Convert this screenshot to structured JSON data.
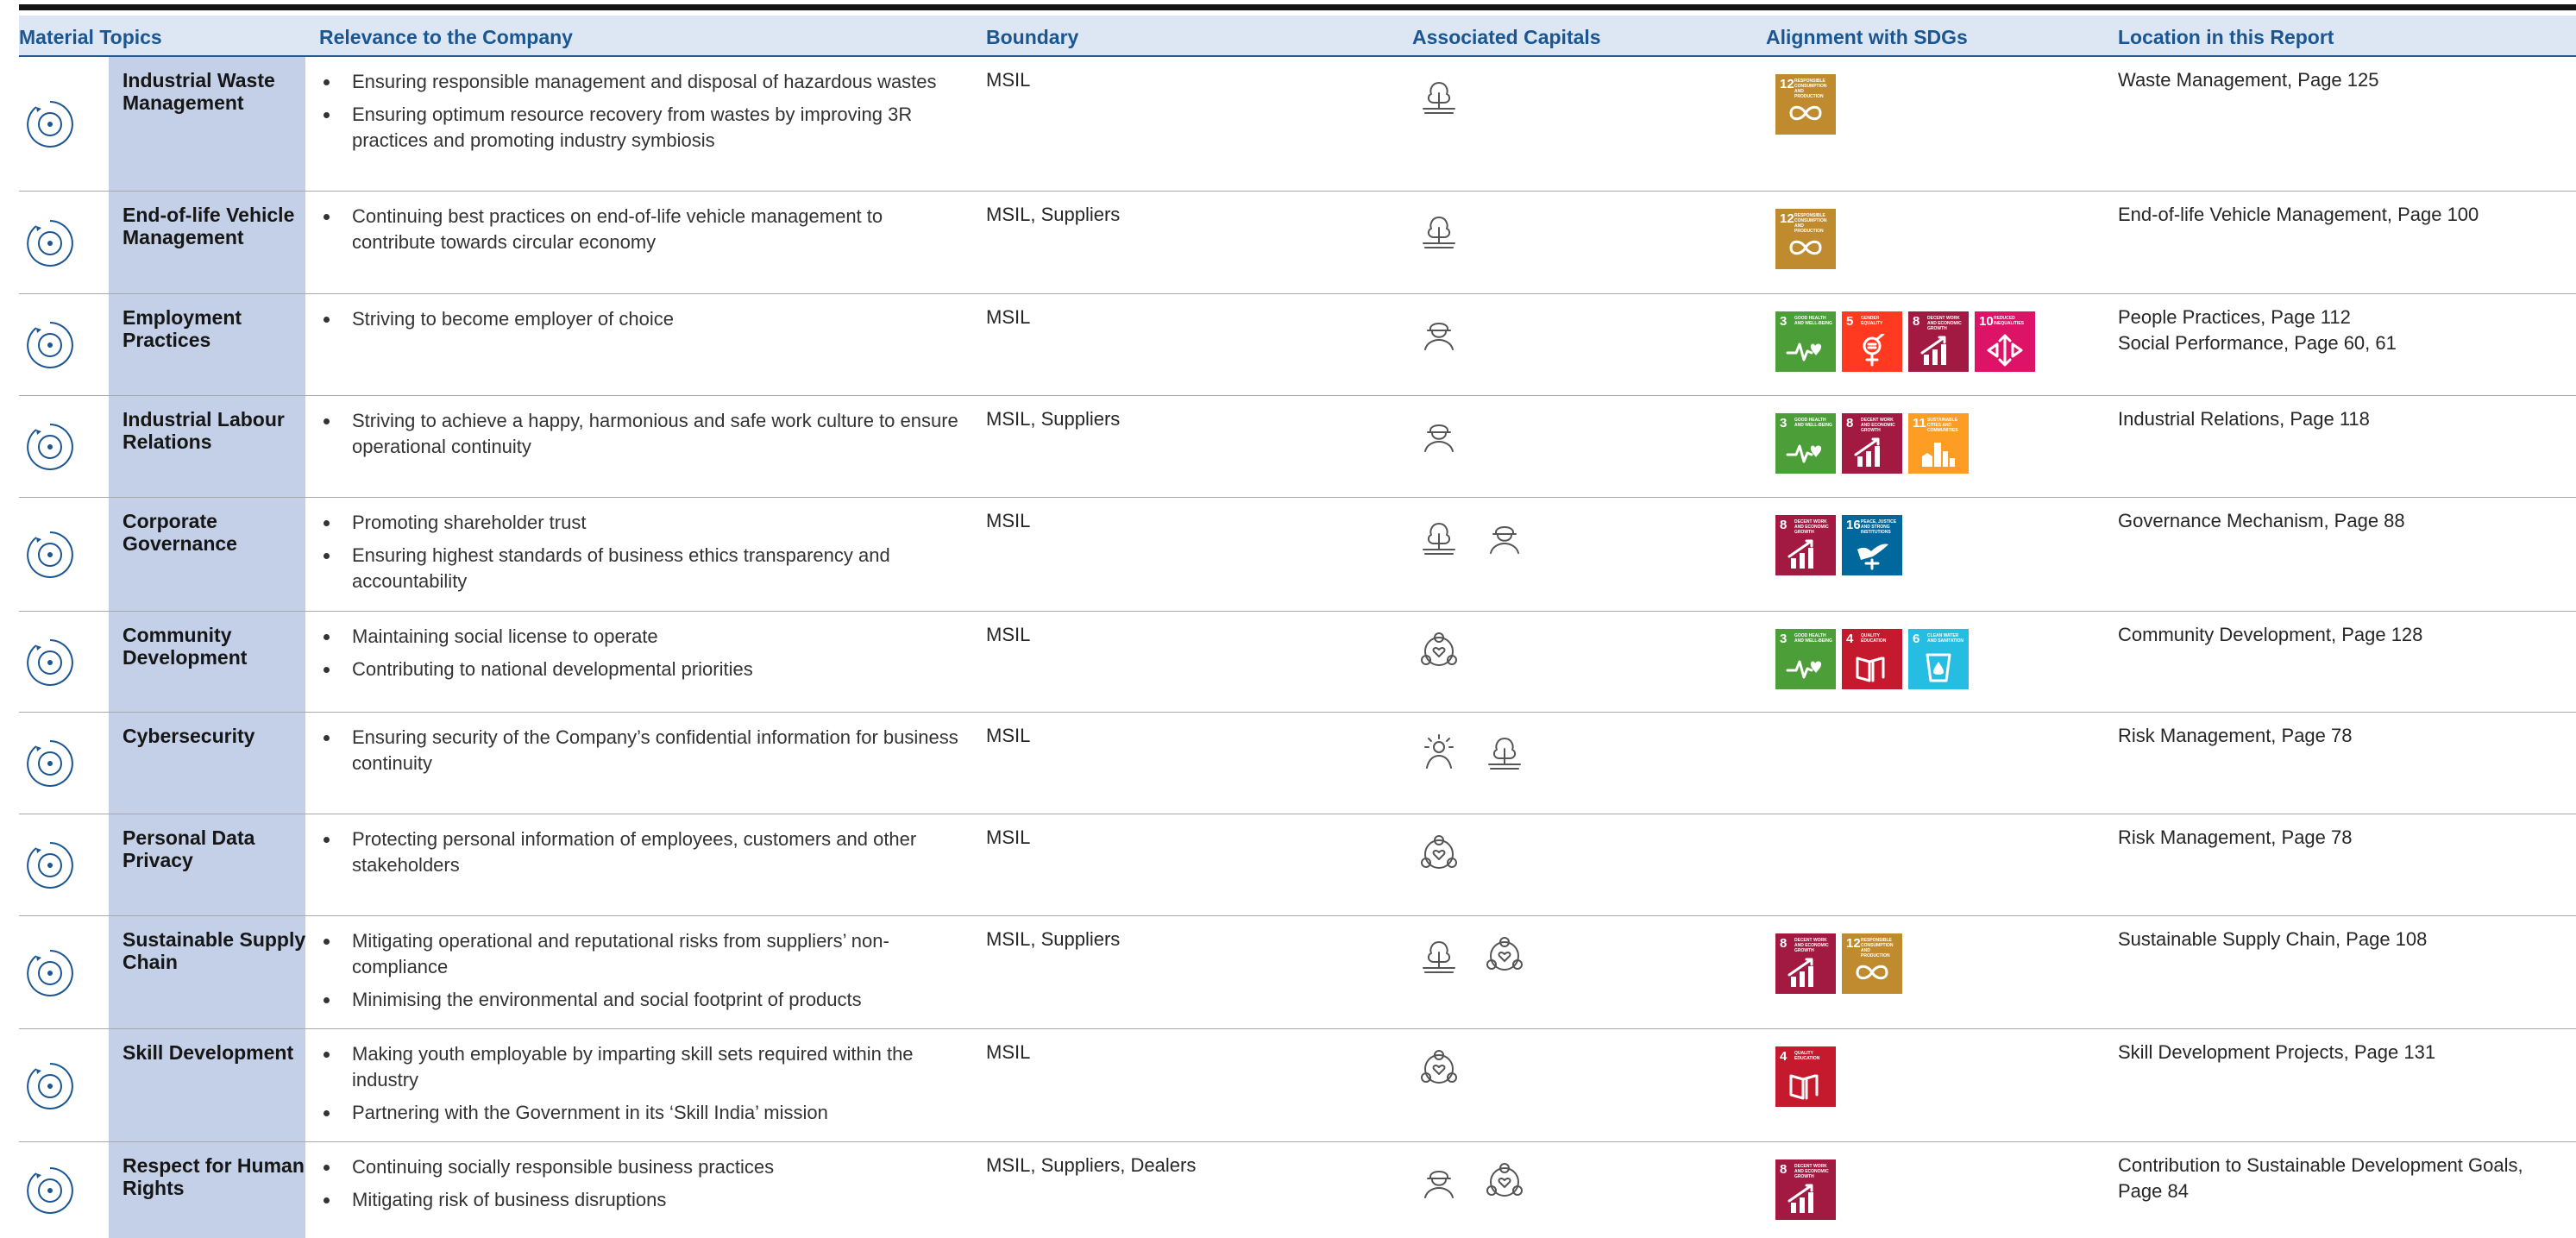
{
  "header": {
    "material_topics": "Material Topics",
    "relevance": "Relevance to the Company",
    "boundary": "Boundary",
    "capitals": "Associated Capitals",
    "sdgs": "Alignment with SDGs",
    "location": "Location in this Report"
  },
  "sdg_catalog": {
    "3": {
      "label": "Good Health and Well-Being",
      "color": "#4c9f38"
    },
    "4": {
      "label": "Quality Education",
      "color": "#c5192d"
    },
    "5": {
      "label": "Gender Equality",
      "color": "#ff3a21"
    },
    "6": {
      "label": "Clean Water and Sanitation",
      "color": "#26bde2"
    },
    "8": {
      "label": "Decent Work and Economic Growth",
      "color": "#a21942"
    },
    "10": {
      "label": "Reduced Inequalities",
      "color": "#dd1367"
    },
    "11": {
      "label": "Sustainable Cities and Communities",
      "color": "#fd9d24"
    },
    "12": {
      "label": "Responsible Consumption and Production",
      "color": "#bf8b2e"
    },
    "16": {
      "label": "Peace, Justice and Strong Institutions",
      "color": "#00689d"
    }
  },
  "rows": [
    {
      "icon": "recycle-bin-icon",
      "title": "Industrial Waste Management",
      "bullets": [
        "Ensuring responsible management and disposal of hazardous wastes",
        "Ensuring optimum resource recovery from wastes by improving 3R practices and promoting industry symbiosis"
      ],
      "boundary": "MSIL",
      "capitals": [
        "natural-capital-icon"
      ],
      "sdgs": [
        "12"
      ],
      "location": [
        "Waste Management, Page 125"
      ]
    },
    {
      "icon": "vehicle-recycle-icon",
      "title": "End-of-life Vehicle Management",
      "bullets": [
        "Continuing best practices on end-of-life vehicle management to contribute towards circular economy"
      ],
      "boundary": "MSIL, Suppliers",
      "capitals": [
        "natural-capital-icon"
      ],
      "sdgs": [
        "12"
      ],
      "location": [
        "End-of-life Vehicle Management, Page 100"
      ]
    },
    {
      "icon": "employees-idea-icon",
      "title": "Employment Practices",
      "bullets": [
        "Striving to become employer of choice"
      ],
      "boundary": "MSIL",
      "capitals": [
        "human-capital-icon"
      ],
      "sdgs": [
        "3",
        "5",
        "8",
        "10"
      ],
      "location": [
        "People Practices, Page 112",
        "Social Performance, Page 60, 61"
      ]
    },
    {
      "icon": "workers-relations-icon",
      "title": "Industrial Labour Relations",
      "bullets": [
        "Striving to achieve a happy, harmonious and safe work culture to ensure operational continuity"
      ],
      "boundary": "MSIL, Suppliers",
      "capitals": [
        "human-capital-icon"
      ],
      "sdgs": [
        "3",
        "8",
        "11"
      ],
      "location": [
        "Industrial Relations, Page 118"
      ]
    },
    {
      "icon": "governance-building-icon",
      "title": "Corporate Governance",
      "bullets": [
        "Promoting shareholder trust",
        "Ensuring highest standards of business ethics transparency and accountability"
      ],
      "boundary": "MSIL",
      "capitals": [
        "natural-capital-icon",
        "human-capital-icon"
      ],
      "sdgs": [
        "8",
        "16"
      ],
      "location": [
        "Governance Mechanism, Page 88"
      ]
    },
    {
      "icon": "community-hands-icon",
      "title": "Community Development",
      "bullets": [
        "Maintaining social license to operate",
        "Contributing to national developmental priorities"
      ],
      "boundary": "MSIL",
      "capitals": [
        "social-capital-icon"
      ],
      "sdgs": [
        "3",
        "4",
        "6"
      ],
      "location": [
        "Community Development, Page 128"
      ]
    },
    {
      "icon": "cyber-network-icon",
      "title": "Cybersecurity",
      "bullets": [
        "Ensuring security of the Company’s confidential information for business continuity"
      ],
      "boundary": "MSIL",
      "capitals": [
        "intellectual-capital-icon",
        "natural-capital-icon"
      ],
      "sdgs": [],
      "location": [
        "Risk Management, Page 78"
      ]
    },
    {
      "icon": "data-privacy-lock-icon",
      "title": "Personal Data Privacy",
      "bullets": [
        "Protecting personal information of employees, customers and other stakeholders"
      ],
      "boundary": "MSIL",
      "capitals": [
        "social-capital-icon"
      ],
      "sdgs": [],
      "location": [
        "Risk Management, Page 78"
      ]
    },
    {
      "icon": "supply-truck-icon",
      "title": "Sustainable Supply Chain",
      "bullets": [
        "Mitigating operational and reputational risks from suppliers’ non-compliance",
        "Minimising the environmental and social footprint of products"
      ],
      "boundary": "MSIL, Suppliers",
      "capitals": [
        "natural-capital-icon",
        "social-capital-icon"
      ],
      "sdgs": [
        "8",
        "12"
      ],
      "location": [
        "Sustainable Supply Chain, Page 108"
      ]
    },
    {
      "icon": "skill-head-icon",
      "title": "Skill Development",
      "bullets": [
        "Making youth employable by imparting skill sets required within the industry",
        "Partnering with the Government in its ‘Skill India’ mission"
      ],
      "boundary": "MSIL",
      "capitals": [
        "social-capital-icon"
      ],
      "sdgs": [
        "4"
      ],
      "location": [
        "Skill Development Projects, Page 131"
      ]
    },
    {
      "icon": "human-rights-people-icon",
      "title": "Respect for Human Rights",
      "bullets": [
        "Continuing socially responsible business practices",
        "Mitigating risk of business disruptions"
      ],
      "boundary": "MSIL, Suppliers, Dealers",
      "capitals": [
        "human-capital-icon",
        "social-capital-icon"
      ],
      "sdgs": [
        "8"
      ],
      "location": [
        "Contribution to Sustainable Development Goals, Page 84"
      ]
    }
  ]
}
